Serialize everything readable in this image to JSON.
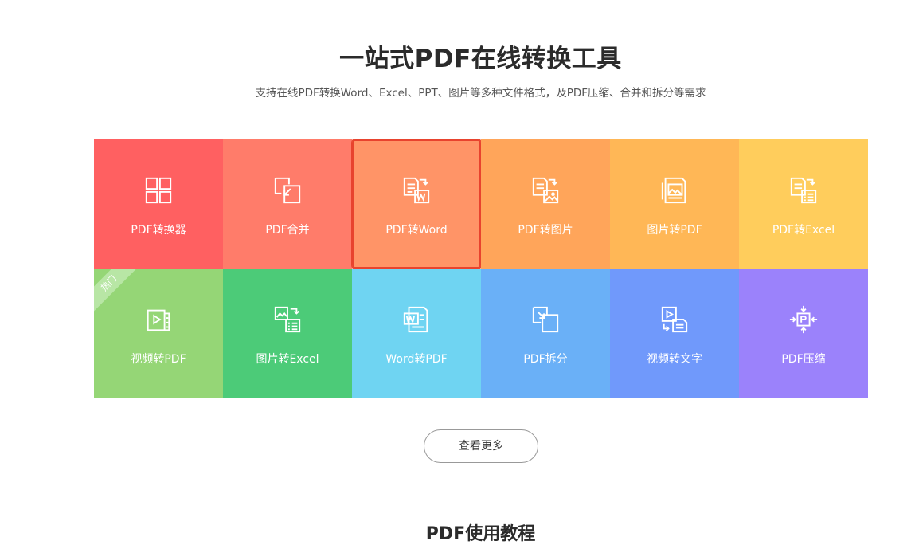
{
  "hero": {
    "title": "一站式PDF在线转换工具",
    "subtitle": "支持在线PDF转换Word、Excel、PPT、图片等多种文件格式，及PDF压缩、合并和拆分等需求"
  },
  "tools": [
    {
      "label": "PDF转换器",
      "icon": "grid-four-icon",
      "color": "#ff6061"
    },
    {
      "label": "PDF合并",
      "icon": "merge-icon",
      "color": "#ff7c6a"
    },
    {
      "label": "PDF转Word",
      "icon": "pdf-to-word-icon",
      "color": "#ff9467",
      "selected": true
    },
    {
      "label": "PDF转图片",
      "icon": "pdf-to-image-icon",
      "color": "#ffa55a"
    },
    {
      "label": "图片转PDF",
      "icon": "image-to-pdf-icon",
      "color": "#ffb756"
    },
    {
      "label": "PDF转Excel",
      "icon": "pdf-to-excel-icon",
      "color": "#ffcd5c"
    },
    {
      "label": "视频转PDF",
      "icon": "video-to-pdf-icon",
      "color": "#95d676",
      "badge": "热门"
    },
    {
      "label": "图片转Excel",
      "icon": "image-to-excel-icon",
      "color": "#4ccb78"
    },
    {
      "label": "Word转PDF",
      "icon": "word-to-pdf-icon",
      "color": "#6fd4f2"
    },
    {
      "label": "PDF拆分",
      "icon": "split-icon",
      "color": "#6ab0f7"
    },
    {
      "label": "视频转文字",
      "icon": "video-to-text-icon",
      "color": "#7099fb"
    },
    {
      "label": "PDF压缩",
      "icon": "compress-icon",
      "color": "#9b82fb"
    }
  ],
  "more_button": "查看更多",
  "next_section_title": "PDF使用教程"
}
